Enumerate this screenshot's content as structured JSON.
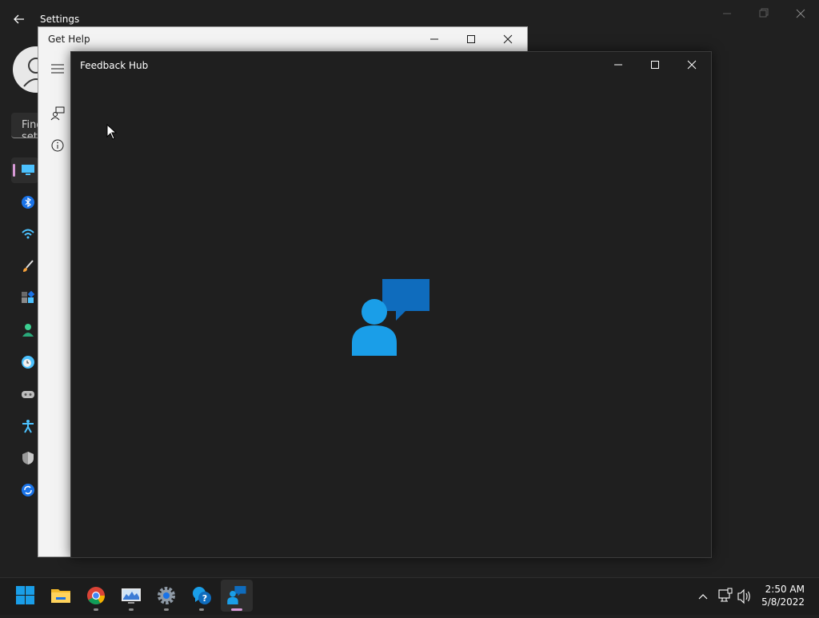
{
  "settings": {
    "title": "Settings",
    "search_placeholder": "Find a setting"
  },
  "get_help": {
    "title": "Get Help"
  },
  "feedback_hub": {
    "title": "Feedback Hub"
  },
  "taskbar": {
    "apps": [
      {
        "name": "Start",
        "icon": "windows-start-icon"
      },
      {
        "name": "File Explorer",
        "icon": "folder-icon"
      },
      {
        "name": "Google Chrome",
        "icon": "chrome-icon"
      },
      {
        "name": "Resource Monitor",
        "icon": "monitor-chart-icon"
      },
      {
        "name": "Settings",
        "icon": "gear-icon"
      },
      {
        "name": "Get Help",
        "icon": "get-help-icon"
      },
      {
        "name": "Feedback Hub",
        "icon": "feedback-hub-icon",
        "active": true
      }
    ],
    "time": "2:50 AM",
    "date": "5/8/2022"
  },
  "colors": {
    "dark_bg": "#202020",
    "accent_blue": "#1a9ee8",
    "accent_pink": "#d89ad7"
  }
}
